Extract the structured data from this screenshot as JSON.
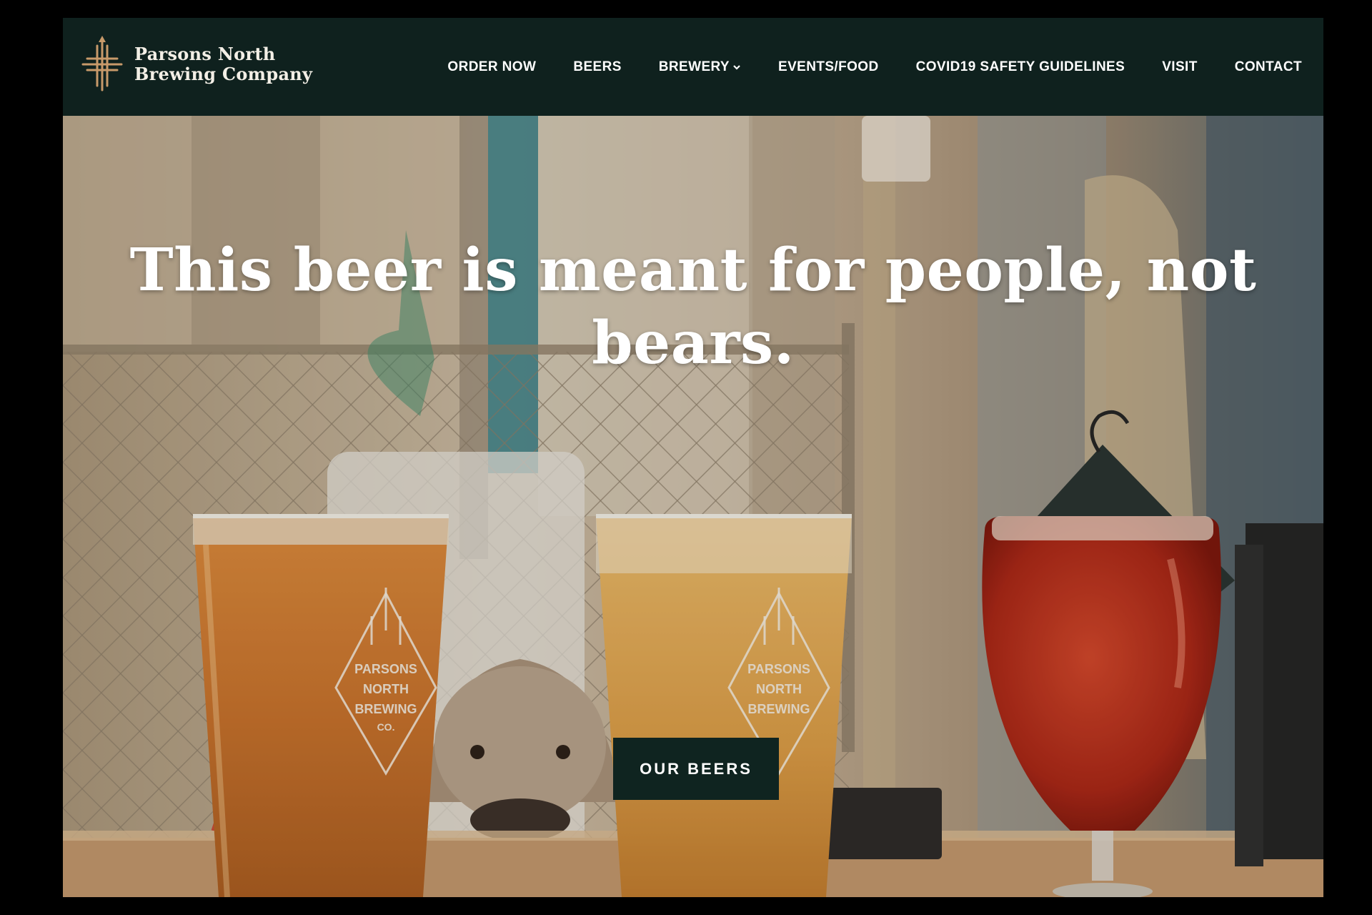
{
  "brand": {
    "name_line1": "Parsons North",
    "name_line2": "Brewing Company"
  },
  "nav": {
    "items": [
      {
        "label": "ORDER NOW"
      },
      {
        "label": "BEERS"
      },
      {
        "label": "BREWERY",
        "has_dropdown": true
      },
      {
        "label": "EVENTS/FOOD"
      },
      {
        "label": "COVID19 SAFETY GUIDELINES"
      },
      {
        "label": "VISIT"
      },
      {
        "label": "CONTACT"
      }
    ]
  },
  "hero": {
    "headline": "This beer is meant for people, not bears.",
    "cta_label": "OUR BEERS",
    "glass_etching": [
      "PARSONS",
      "NORTH",
      "BREWING",
      "CO."
    ]
  },
  "colors": {
    "header_bg": "#0f211e",
    "cta_bg": "#0f2420",
    "logo_accent": "#c89a6a"
  }
}
